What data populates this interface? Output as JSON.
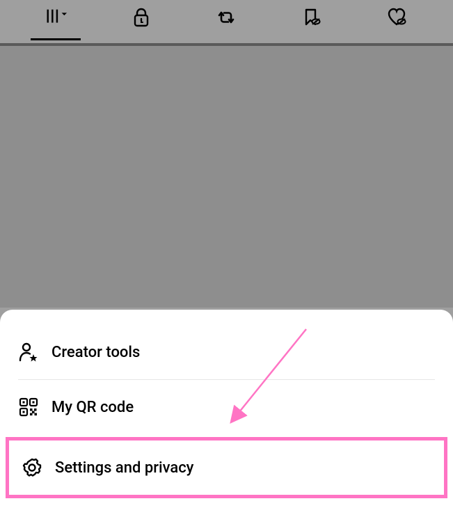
{
  "tabs": {
    "items": [
      {
        "name": "tab-grid",
        "active": true
      },
      {
        "name": "tab-locked",
        "active": false
      },
      {
        "name": "tab-reposts",
        "active": false
      },
      {
        "name": "tab-saved",
        "active": false
      },
      {
        "name": "tab-liked",
        "active": false
      }
    ]
  },
  "menu": {
    "creator_tools": {
      "label": "Creator tools",
      "icon": "creator-star-icon"
    },
    "qr_code": {
      "label": "My QR code",
      "icon": "qr-icon"
    },
    "settings": {
      "label": "Settings and privacy",
      "icon": "gear-icon"
    }
  },
  "annotation": {
    "highlight_color": "#ff74c4",
    "arrow_color": "#ff74c4"
  }
}
